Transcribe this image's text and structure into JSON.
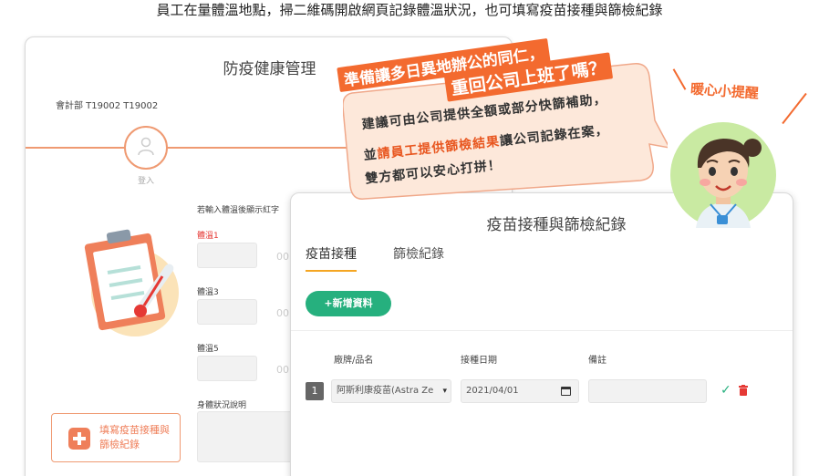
{
  "headline": "員工在量體溫地點，掃二維碼開啟網頁記錄體溫狀況，也可填寫疫苗接種與篩檢紀錄",
  "health": {
    "title": "防疫健康管理",
    "department": "會計部 T19002 T19002",
    "step_label": "登入",
    "hint": "若輸入體溫後顯示紅字",
    "temp1_label": "體溫1",
    "temp3_label": "體溫3",
    "temp5_label": "體溫5",
    "ghost_text": "00",
    "desc_label": "身體狀況說明",
    "fill_button": "填寫疫苗接種與篩檢紀錄"
  },
  "vaccine": {
    "title": "疫苗接種與篩檢紀錄",
    "tabs": [
      "疫苗接種",
      "篩檢紀錄"
    ],
    "add_button": "+新增資料",
    "columns": [
      "廠牌/品名",
      "接種日期",
      "備註"
    ],
    "row": {
      "index": "1",
      "brand": "阿斯利康疫苗(Astra Ze",
      "date": "2021/04/01",
      "note": ""
    }
  },
  "bubble": {
    "banner1": "準備讓多日異地辦公的同仁，",
    "banner2": "重回公司上班了嗎？",
    "line1": "建議可由公司提供全額或部分快篩補助，",
    "line2_pre": "並",
    "line2_highlight": "請員工提供篩檢結果",
    "line2_post": "讓公司記錄在案，",
    "line3": "雙方都可以安心打拼！"
  },
  "tip_title": "暖心小提醒",
  "colors": {
    "accent": "#f36a2f",
    "green": "#26b07e",
    "tab_underline": "#f5a623"
  }
}
